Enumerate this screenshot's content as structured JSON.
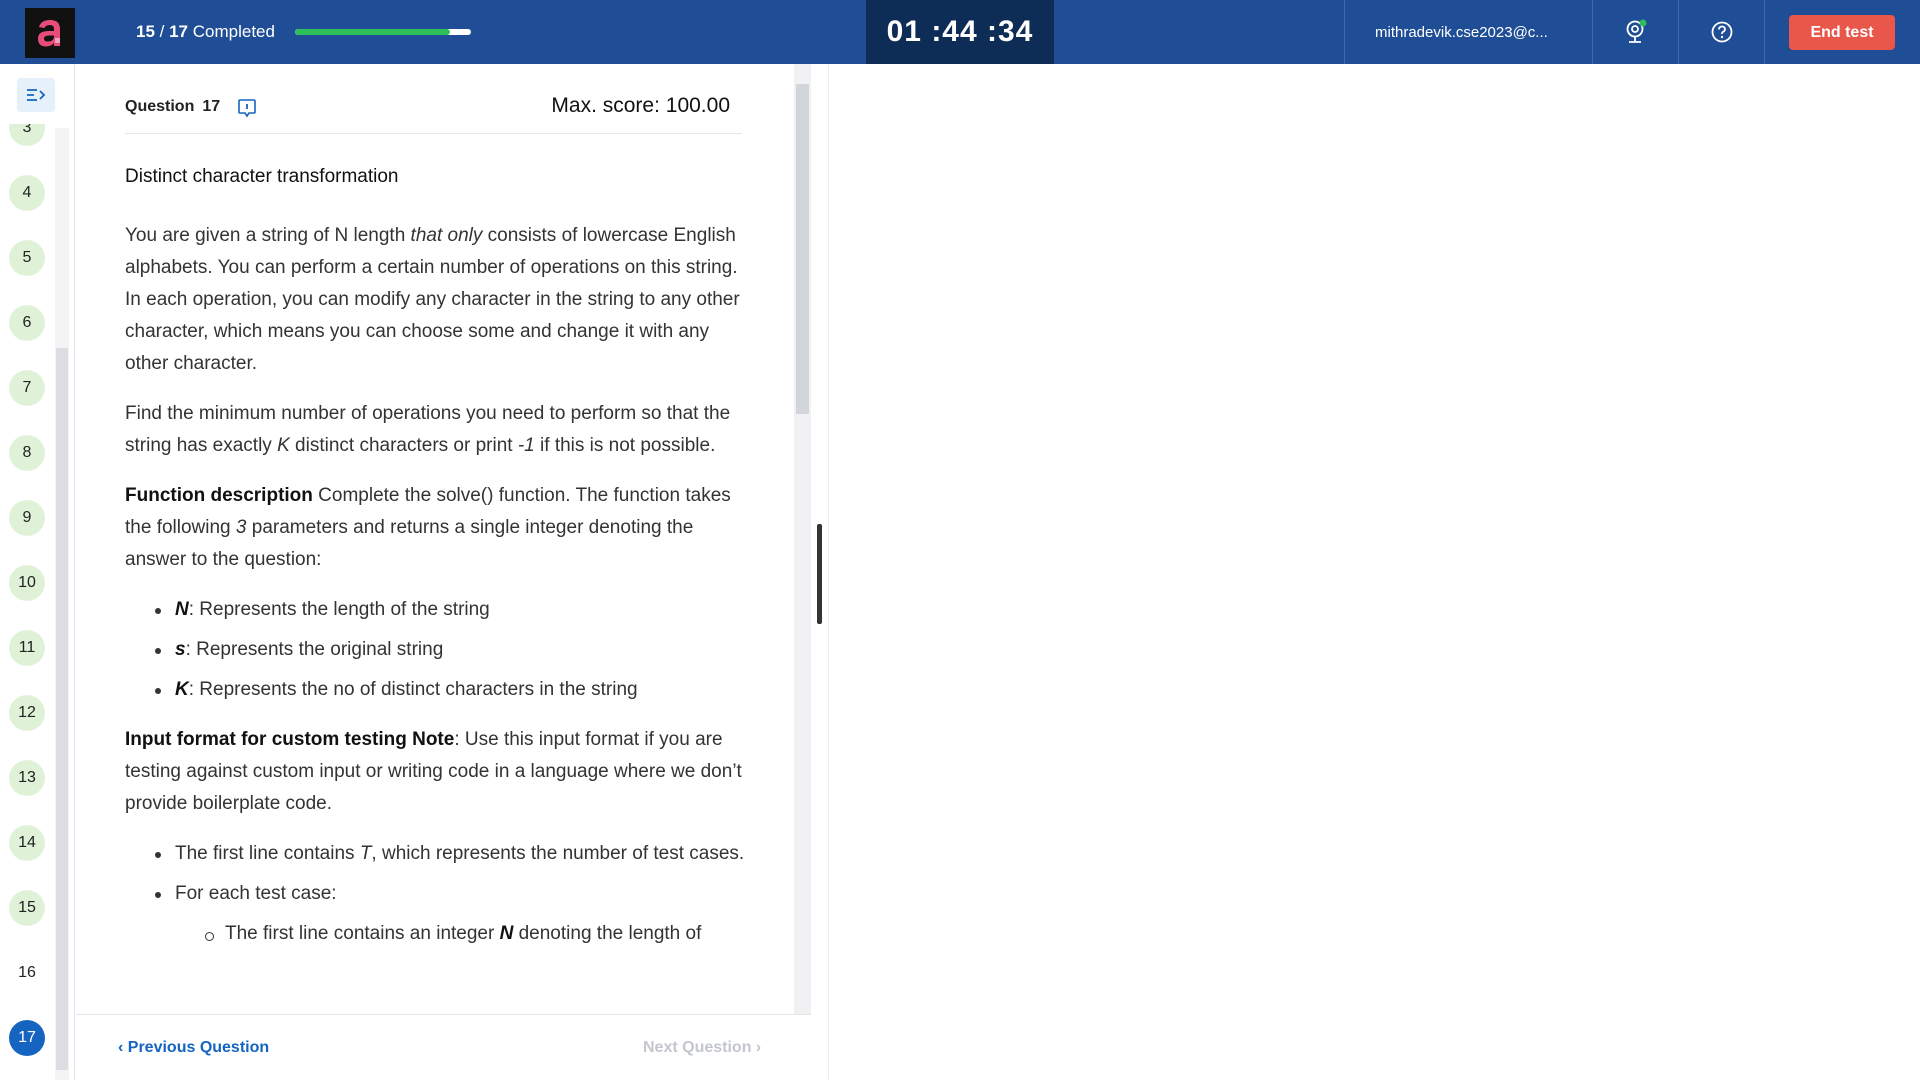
{
  "header": {
    "progress_done": "15",
    "progress_sep": " / ",
    "progress_total": "17",
    "progress_suffix": "Completed",
    "progress_fraction": 0.88,
    "timer": "01 :44 :34",
    "user_email": "mithradevik.cse2023@c...",
    "end_test_label": "End test",
    "colors": {
      "bar": "#1f4e96",
      "timer_bg": "#0d2c56",
      "end_button": "#e8574a",
      "progress_fill": "#2fbf5a"
    }
  },
  "sidebar": {
    "toggle_icon": "collapse-panel-icon",
    "questions": [
      "3",
      "4",
      "5",
      "6",
      "7",
      "8",
      "9",
      "10",
      "11",
      "12",
      "13",
      "14",
      "15",
      "16",
      "17"
    ],
    "answered_color": "#dff2d8",
    "active_color": "#1565c0"
  },
  "question": {
    "label": "Question",
    "number": "17",
    "max_score": "Max. score: 100.00",
    "title": "Distinct character transformation",
    "p1_a": "You are given a string of N length ",
    "p1_em": "that only",
    "p1_b": " consists of lowercase English alphabets. You can perform a certain number of operations on this string. In each operation, you can modify any character in the string to any other character, which means you can choose some and change it with any other character.",
    "p2_a": "Find the minimum number of operations you need to perform so that the string has exactly ",
    "p2_k": "K",
    "p2_b": " distinct characters or print ",
    "p2_neg": "-1",
    "p2_c": " if this is not possible.",
    "fd_label": "Function description",
    "fd_a": " Complete the solve() function. The function takes the following ",
    "fd_num": "3",
    "fd_b": " parameters and returns a single integer denoting the answer to the question:",
    "params": [
      {
        "name": "N",
        "sep": ":",
        "desc": " Represents the length of the string"
      },
      {
        "name": "s",
        "sep": ":",
        "desc": "  Represents the original string"
      },
      {
        "name": "K",
        "sep": ":",
        "desc": "  Represents the no of distinct characters in the string"
      }
    ],
    "if_label": "Input format for custom testing Note",
    "if_text": ": Use this input format if you are testing against custom input or writing code in a language where we don’t provide boilerplate code.",
    "tc_a": "The first line contains ",
    "tc_t": "T",
    "tc_b": ", which represents the number of test cases.",
    "each_case": "For each test case:",
    "sub_a": "The first line contains an integer ",
    "sub_n": "N",
    "sub_b": " denoting the length of"
  },
  "footer": {
    "prev_label": "Previous Question",
    "next_label": "Next Question"
  }
}
